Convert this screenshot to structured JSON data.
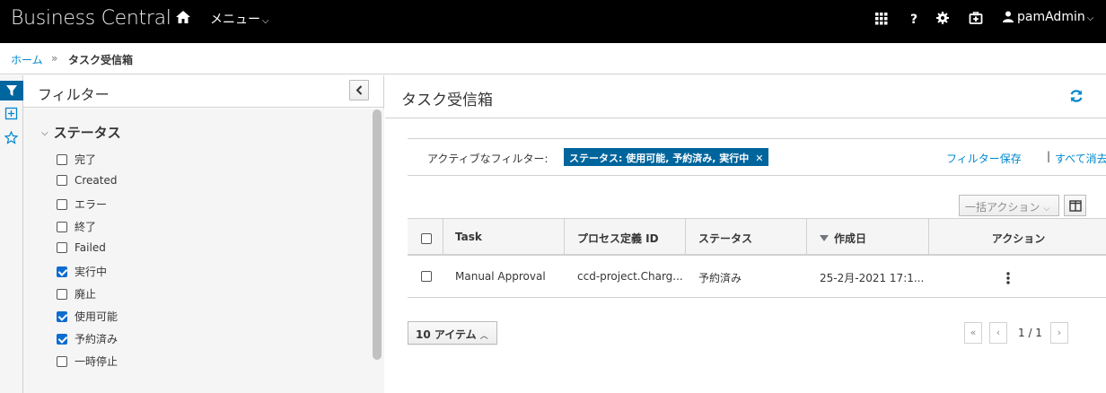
{
  "topbar": {
    "brand": "Business Central",
    "menu_label": "メニュー",
    "user_label": "pamAdmin"
  },
  "breadcrumb": {
    "home": "ホーム",
    "separator": "»",
    "current": "タスク受信箱"
  },
  "filter_panel": {
    "title": "フィルター",
    "status_heading": "ステータス",
    "status_options": [
      {
        "label": "完了",
        "checked": false
      },
      {
        "label": "Created",
        "checked": false
      },
      {
        "label": "エラー",
        "checked": false
      },
      {
        "label": "終了",
        "checked": false
      },
      {
        "label": "Failed",
        "checked": false
      },
      {
        "label": "実行中",
        "checked": true
      },
      {
        "label": "廃止",
        "checked": false
      },
      {
        "label": "使用可能",
        "checked": true
      },
      {
        "label": "予約済み",
        "checked": true
      },
      {
        "label": "一時停止",
        "checked": false
      }
    ]
  },
  "main": {
    "title": "タスク受信箱",
    "active_filters_label": "アクティブなフィルター:",
    "active_filter_chip": "ステータス: 使用可能, 予約済み, 実行中",
    "save_filter": "フィルター保存",
    "pipe": "|",
    "clear_all": "すべて消去",
    "bulk_actions": "一括アクション",
    "columns": [
      "Task",
      "プロセス定義 ID",
      "ステータス",
      "作成日",
      "アクション"
    ],
    "rows": [
      {
        "task": "Manual Approval",
        "process_def": "ccd-project.Charg...",
        "status": "予約済み",
        "created": "25-2月-2021 17:1..."
      }
    ],
    "page_size": "10 アイテム",
    "first": "«",
    "prev": "‹",
    "next": "›",
    "page_indicator": "1 / 1"
  },
  "colors": {
    "topbar_bg": "#000000",
    "link": "#0088ce",
    "chip_bg": "#00659c",
    "checkbox_checked": "#0d6ccf"
  }
}
